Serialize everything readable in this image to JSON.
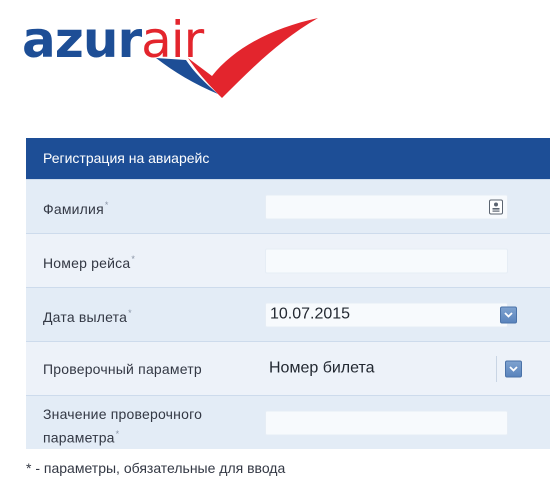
{
  "logo": {
    "part1": "azur",
    "part2": "air",
    "color_primary": "#1d4e96",
    "color_accent": "#e3252d"
  },
  "form": {
    "title": "Регистрация на авиарейс",
    "header_color": "#1d4e96",
    "required_marker": "*",
    "rows": [
      {
        "label": "Фамилия",
        "value": "",
        "icon": "contact-card-icon"
      },
      {
        "label": "Номер рейса",
        "value": ""
      },
      {
        "label": "Дата вылета",
        "value": "10.07.2015",
        "icon": "chevron-down-icon"
      },
      {
        "label": "Проверочный параметр",
        "value": "Номер билета",
        "icon": "chevron-down-icon"
      },
      {
        "label": "Значение проверочного параметра",
        "value": ""
      }
    ],
    "footnote": "* - параметры, обязательные для ввода"
  }
}
